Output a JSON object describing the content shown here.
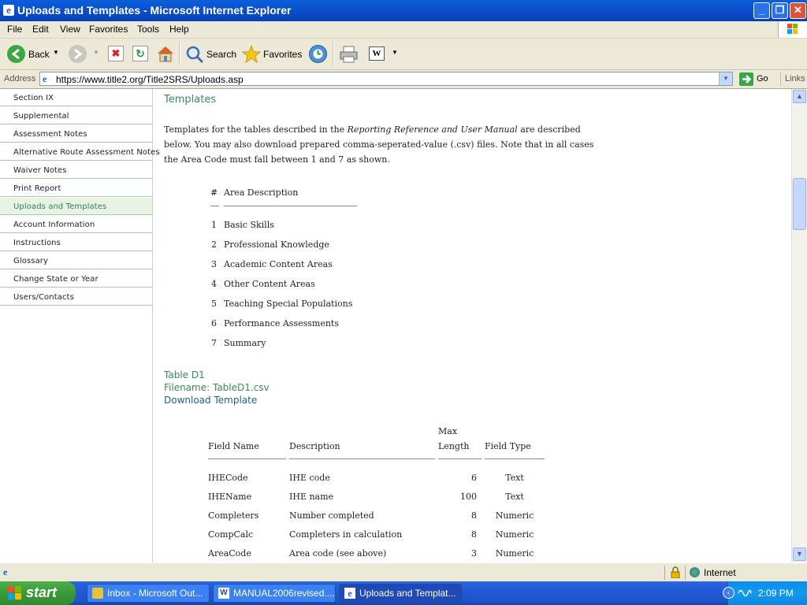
{
  "window": {
    "title": "Uploads and Templates - Microsoft Internet Explorer",
    "controls": [
      "minimize",
      "maximize",
      "close"
    ]
  },
  "menu": [
    "File",
    "Edit",
    "View",
    "Favorites",
    "Tools",
    "Help"
  ],
  "toolbar": {
    "back": "Back",
    "search": "Search",
    "favorites": "Favorites"
  },
  "address": {
    "label": "Address",
    "url": "https://www.title2.org/Title2SRS/Uploads.asp",
    "go": "Go",
    "links": "Links"
  },
  "nav": {
    "items": [
      "Section IX",
      "Supplemental",
      "Assessment Notes",
      "Alternative Route Assessment Notes",
      "Waiver Notes",
      "Print Report",
      "Uploads and Templates",
      "Account Information",
      "Instructions",
      "Glossary",
      "Change State or Year",
      "Users/Contacts"
    ],
    "active_index": 6
  },
  "main": {
    "title": "Templates",
    "intro_pre": "Templates for the tables described in the ",
    "intro_em": "Reporting Reference and User Manual",
    "intro_post": " are described below. You may also download prepared comma-seperated-value (.csv) files. Note that in all cases the Area Code must fall between 1 and 7 as shown.",
    "area_table": {
      "headers": [
        "#",
        "Area Description"
      ],
      "rows": [
        [
          "1",
          "Basic Skills"
        ],
        [
          "2",
          "Professional Knowledge"
        ],
        [
          "3",
          "Academic Content Areas"
        ],
        [
          "4",
          "Other Content Areas"
        ],
        [
          "5",
          "Teaching Special Populations"
        ],
        [
          "6",
          "Performance Assessments"
        ],
        [
          "7",
          "Summary"
        ]
      ]
    },
    "table_d1": {
      "title": "Table D1",
      "filename": "Filename: TableD1.csv",
      "download": "Download Template",
      "headers": {
        "field": "Field Name",
        "desc": "Description",
        "max1": "Max",
        "max2": "Length",
        "type": "Field Type"
      },
      "rows": [
        [
          "IHECode",
          "IHE code",
          "6",
          "Text"
        ],
        [
          "IHEName",
          "IHE name",
          "100",
          "Text"
        ],
        [
          "Completers",
          "Number completed",
          "8",
          "Numeric"
        ],
        [
          "CompCalc",
          "Completers in calculation",
          "8",
          "Numeric"
        ],
        [
          "AreaCode",
          "Area code (see above)",
          "3",
          "Numeric"
        ]
      ]
    }
  },
  "status": {
    "zone": "Internet"
  },
  "taskbar": {
    "start": "start",
    "tasks": [
      "Inbox - Microsoft Out...",
      "MANUAL2006revised....",
      "Uploads and Templat..."
    ],
    "clock": "2:09 PM"
  }
}
